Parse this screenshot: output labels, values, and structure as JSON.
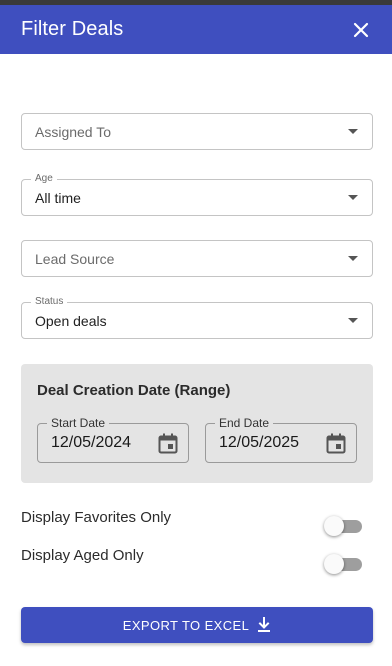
{
  "header": {
    "title": "Filter Deals",
    "close_icon": "close-icon"
  },
  "filters": {
    "assigned_to": {
      "placeholder": "Assigned To"
    },
    "age": {
      "label": "Age",
      "value": "All time"
    },
    "lead_source": {
      "placeholder": "Lead Source"
    },
    "status": {
      "label": "Status",
      "value": "Open deals"
    }
  },
  "date_range": {
    "title": "Deal Creation Date (Range)",
    "start": {
      "label": "Start Date",
      "value": "12/05/2024"
    },
    "end": {
      "label": "End Date",
      "value": "12/05/2025"
    }
  },
  "toggles": {
    "favorites": {
      "label": "Display Favorites Only",
      "checked": false
    },
    "aged": {
      "label": "Display Aged Only",
      "checked": false
    }
  },
  "export": {
    "label": "EXPORT TO EXCEL",
    "icon": "download-icon"
  },
  "colors": {
    "primary": "#3f4fbf",
    "panel": "#e4e4e4",
    "border": "#c4c4c4"
  }
}
